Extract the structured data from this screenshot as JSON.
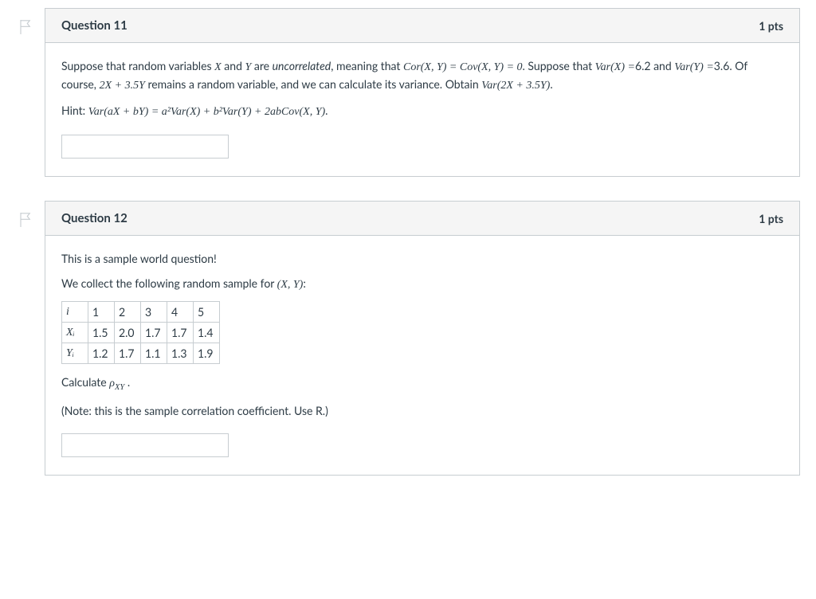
{
  "questions": [
    {
      "title": "Question 11",
      "points": "1 pts",
      "body": {
        "p1_a": "Suppose that random variables ",
        "p1_X": "X",
        "p1_b": " and ",
        "p1_Y": "Y",
        "p1_c": " are ",
        "p1_uncorr": "uncorrelated",
        "p1_d": ", meaning that ",
        "p1_cor": "Cor(X, Y) = Cov(X, Y) = 0",
        "p1_e": ". Suppose that ",
        "p1_varx": "Var(X) =",
        "p1_varxv": "6.2",
        "p1_f": " and ",
        "p1_vary": "Var(Y) =",
        "p1_varyv": "3.6",
        "p1_g": ". Of course, ",
        "p1_expr": "2X + 3.5Y",
        "p1_h": " remains a random variable, and we can calculate its variance. Obtain ",
        "p1_target": "Var(2X + 3.5Y)",
        "p1_i": ".",
        "hint_a": "Hint: ",
        "hint_eq": "Var(aX + bY) = a²Var(X) + b²Var(Y) + 2abCov(X, Y)",
        "hint_b": "."
      }
    },
    {
      "title": "Question 12",
      "points": "1 pts",
      "body": {
        "intro": "This is a sample world question!",
        "collect_a": "We collect the following random sample for ",
        "collect_xy": "(X, Y)",
        "collect_b": ":",
        "calc_a": "Calculate ",
        "calc_rho": "ρ",
        "calc_sub": "XY",
        "calc_b": " .",
        "note": "(Note: this is the sample correlation coefficient. Use R.)"
      },
      "table": {
        "rows": [
          [
            "i",
            "1",
            "2",
            "3",
            "4",
            "5"
          ],
          [
            "Xᵢ",
            "1.5",
            "2.0",
            "1.7",
            "1.7",
            "1.4"
          ],
          [
            "Yᵢ",
            "1.2",
            "1.7",
            "1.1",
            "1.3",
            "1.9"
          ]
        ]
      }
    }
  ]
}
